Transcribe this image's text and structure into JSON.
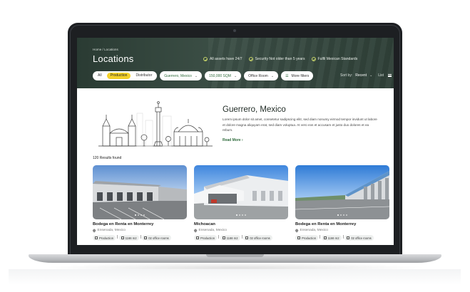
{
  "breadcrumb": "Home / Locations",
  "page_title": "Locations",
  "badges": [
    "All assets have 24/7",
    "Security Not older than 5 years",
    "Fulfil Mexican Standards"
  ],
  "filters": {
    "segment": [
      "All",
      "Production",
      "Distributor"
    ],
    "active_segment": "Production",
    "location": "Guerrero, Mexico",
    "size": "150,000 SQM",
    "room": "Office Room",
    "more": "More filters"
  },
  "sort": {
    "label": "Sort by:",
    "value": "Recent",
    "view": "List"
  },
  "intro": {
    "title": "Guerrero, Mexico",
    "description": "Lorem ipsum dolor sit amet, consetetur sadipscing elitr, sed diam nonumy eirmod tempor invidunt ut labore et dolore magna aliquyam erat, sed diam voluptua. At vero eos et accusam et justo duo dolores et ea rebum.",
    "read_more": "Read More"
  },
  "results_count": "120 Results found",
  "cards": [
    {
      "name": "Bodega en Renta en Monterrey",
      "place": "Ensenada, Mexico",
      "tags": [
        "Production",
        "1166 m2",
        "02 office rooms"
      ]
    },
    {
      "name": "Michoacan",
      "place": "Ensenada, Mexico",
      "tags": [
        "Production",
        "1166 m2",
        "02 office rooms"
      ]
    },
    {
      "name": "Bodega en Renta en Monterrey",
      "place": "Ensenada, Mexico",
      "tags": [
        "Production",
        "1166 m2",
        "02 office rooms"
      ]
    }
  ],
  "colors": {
    "hero": "#2f4038",
    "accent": "#f4d12a",
    "link": "#2f6b3c"
  }
}
